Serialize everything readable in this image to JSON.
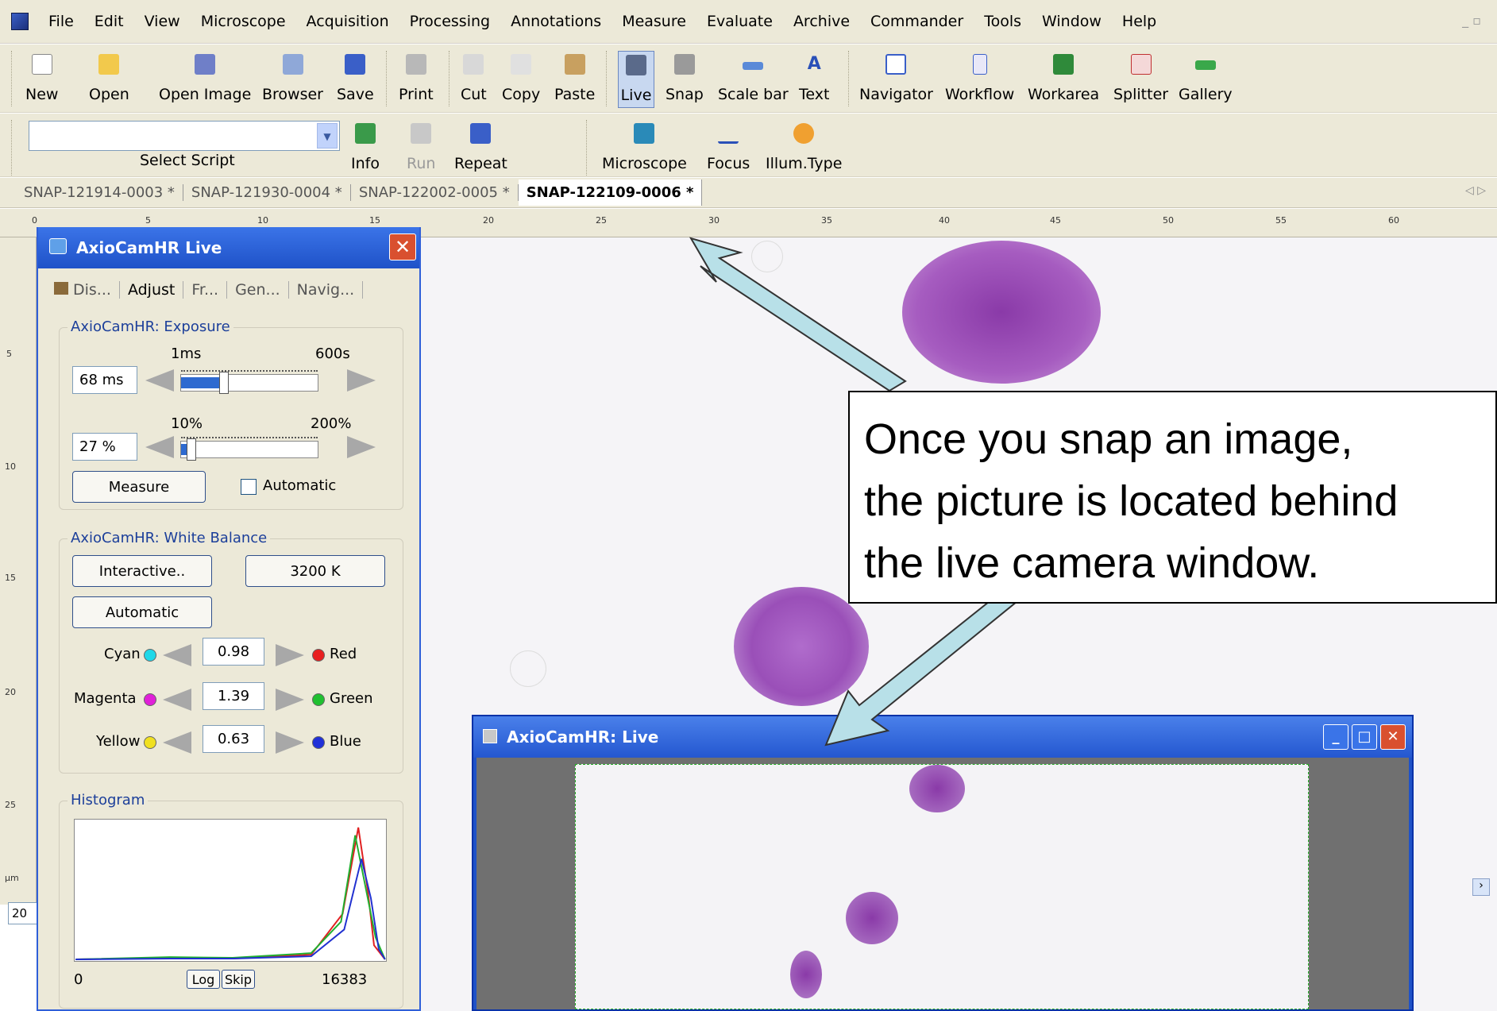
{
  "menubar": {
    "items": [
      "File",
      "Edit",
      "View",
      "Microscope",
      "Acquisition",
      "Processing",
      "Annotations",
      "Measure",
      "Evaluate",
      "Archive",
      "Commander",
      "Tools",
      "Window",
      "Help"
    ]
  },
  "toolbar1": {
    "buttons": [
      {
        "label": "New",
        "icon": "new-document-icon"
      },
      {
        "label": "Open",
        "icon": "open-folder-icon"
      },
      {
        "label": "Open Image",
        "icon": "open-image-icon"
      },
      {
        "label": "Browser",
        "icon": "browser-icon"
      },
      {
        "label": "Save",
        "icon": "floppy-disk-icon"
      },
      {
        "label": "Print",
        "icon": "printer-icon"
      },
      {
        "label": "Cut",
        "icon": "scissors-icon"
      },
      {
        "label": "Copy",
        "icon": "copy-icon"
      },
      {
        "label": "Paste",
        "icon": "paste-icon"
      },
      {
        "label": "Live",
        "icon": "live-camera-icon"
      },
      {
        "label": "Snap",
        "icon": "camera-snap-icon"
      },
      {
        "label": "Scale bar",
        "icon": "scale-bar-icon"
      },
      {
        "label": "Text",
        "icon": "text-icon"
      },
      {
        "label": "Navigator",
        "icon": "navigator-icon"
      },
      {
        "label": "Workflow",
        "icon": "workflow-icon"
      },
      {
        "label": "Workarea",
        "icon": "workarea-icon"
      },
      {
        "label": "Splitter",
        "icon": "splitter-icon"
      },
      {
        "label": "Gallery",
        "icon": "gallery-icon"
      }
    ]
  },
  "toolbar2": {
    "script_label": "Select Script",
    "buttons": [
      {
        "label": "Info",
        "icon": "info-icon"
      },
      {
        "label": "Run",
        "icon": "run-icon"
      },
      {
        "label": "Repeat",
        "icon": "repeat-icon"
      },
      {
        "label": "Microscope",
        "icon": "microscope-icon"
      },
      {
        "label": "Focus",
        "icon": "focus-icon"
      },
      {
        "label": "Illum.Type",
        "icon": "illumination-icon"
      }
    ]
  },
  "doc_tabs": [
    "SNAP-121914-0003 *",
    "SNAP-121930-0004 *",
    "SNAP-122002-0005 *",
    "SNAP-122109-0006 *"
  ],
  "ruler": {
    "top_ticks": [
      "0",
      "5",
      "10",
      "15",
      "20",
      "25",
      "30",
      "35",
      "40",
      "45",
      "50",
      "55",
      "60"
    ],
    "left_ticks": [
      "5",
      "10",
      "15",
      "20",
      "25"
    ],
    "unit": "µm",
    "zoom_value": "20"
  },
  "panel": {
    "title": "AxioCamHR Live",
    "tabs": [
      "Dis...",
      "Adjust",
      "Fr...",
      "Gen...",
      "Navig..."
    ],
    "exposure": {
      "group_title": "AxioCamHR: Exposure",
      "min_label": "1ms",
      "max_label": "600s",
      "time_value": "68 ms",
      "pct_min_label": "10%",
      "pct_max_label": "200%",
      "pct_value": "27 %",
      "measure_label": "Measure",
      "automatic_label": "Automatic"
    },
    "white_balance": {
      "group_title": "AxioCamHR: White Balance",
      "interactive_label": "Interactive..",
      "kelvin_label": "3200 K",
      "automatic_label": "Automatic",
      "cyan_label": "Cyan",
      "red_label": "Red",
      "cyan_value": "0.98",
      "magenta_label": "Magenta",
      "green_label": "Green",
      "magenta_value": "1.39",
      "yellow_label": "Yellow",
      "blue_label": "Blue",
      "yellow_value": "0.63"
    },
    "histogram": {
      "group_title": "Histogram",
      "min_label": "0",
      "max_label": "16383",
      "log_label": "Log",
      "skip_label": "Skip"
    }
  },
  "live_window": {
    "title": "AxioCamHR: Live"
  },
  "callout": {
    "line1": "Once you snap an image,",
    "line2": "the picture is located behind",
    "line3": "the live camera window."
  },
  "colors": {
    "accent": "#2457d0",
    "callout_arrow": "#b8e0e8",
    "cell": "#9a4fb0",
    "chrome": "#ece9d8"
  }
}
